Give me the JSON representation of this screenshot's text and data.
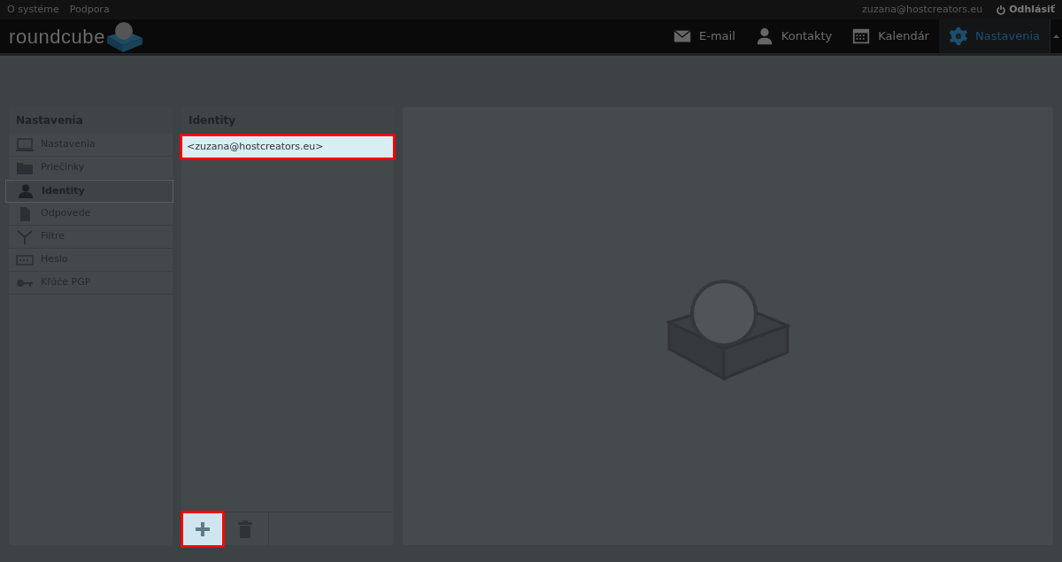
{
  "top_links": [
    "O systéme",
    "Podpora"
  ],
  "user": "zuzana@hostcreators.eu",
  "logout": "Odhlásiť",
  "logo": "roundcube",
  "nav": [
    {
      "kind": "mail",
      "label": "E-mail",
      "selected": false
    },
    {
      "kind": "contacts",
      "label": "Kontakty",
      "selected": false
    },
    {
      "kind": "calendar",
      "label": "Kalendár",
      "selected": false
    },
    {
      "kind": "settings",
      "label": "Nastavenia",
      "selected": true
    }
  ],
  "sidebar": {
    "title": "Nastavenia",
    "items": [
      {
        "kind": "computer",
        "label": "Nastavenia",
        "selected": false
      },
      {
        "kind": "folder",
        "label": "Priečinky",
        "selected": false
      },
      {
        "kind": "person",
        "label": "Identity",
        "selected": true
      },
      {
        "kind": "document",
        "label": "Odpovede",
        "selected": false
      },
      {
        "kind": "filter",
        "label": "Filtre",
        "selected": false
      },
      {
        "kind": "password",
        "label": "Heslo",
        "selected": false
      },
      {
        "kind": "key",
        "label": "Kľúče PGP",
        "selected": false
      }
    ]
  },
  "identities": {
    "title": "Identity",
    "items": [
      {
        "label": "<zuzana@hostcreators.eu>",
        "selected": true,
        "highlighted": true
      }
    ],
    "toolbar": [
      {
        "kind": "add",
        "disabled": false,
        "highlighted": true
      },
      {
        "kind": "delete",
        "disabled": true,
        "highlighted": false
      }
    ]
  }
}
